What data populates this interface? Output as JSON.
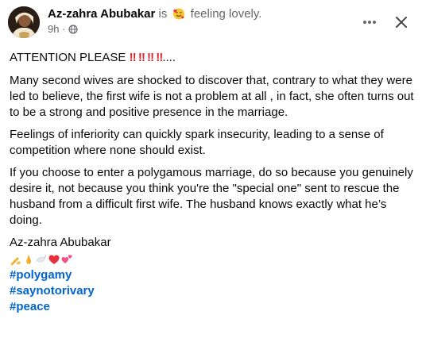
{
  "post": {
    "author": "Az-zahra Abubakar",
    "is_word": "is",
    "feeling": "feeling lovely.",
    "feeling_emoji": "smiling-face-with-hearts",
    "timestamp": "9h",
    "separator": "·",
    "audience": "public-globe-icon",
    "actions": {
      "more_label": "···",
      "close_label": "✕"
    },
    "headline": {
      "text": "ATTENTION PLEASE",
      "marks": "‼️‼️‼️‼️",
      "trailing": "...."
    },
    "paragraphs": [
      "Many second wives are shocked to discover that, contrary to what they were led to believe, the first wife is not a problem at all , in fact, she often turns out to be a strong and positive presence in the marriage.",
      "Feelings of inferiority can quickly spark insecurity, leading to a sense of competition where none should exist.",
      "If you choose to enter a polygamous marriage, do so because you genuinely desire it,  not because you think you're the \"special one\" sent to rescue the husband from a difficult first wife. The husband knows exactly what he’s doing."
    ],
    "signature": "Az-zahra Abubakar",
    "emoji_line": [
      "writing-hand",
      "folded-hands",
      "dove",
      "red-heart",
      "two-hearts"
    ],
    "hashtags": [
      "#polygamy",
      "#saynotorivary",
      "#peace"
    ]
  },
  "colors": {
    "text": "#080809",
    "muted": "#65676b",
    "link": "#0064d1",
    "bang": "#e0232d"
  }
}
